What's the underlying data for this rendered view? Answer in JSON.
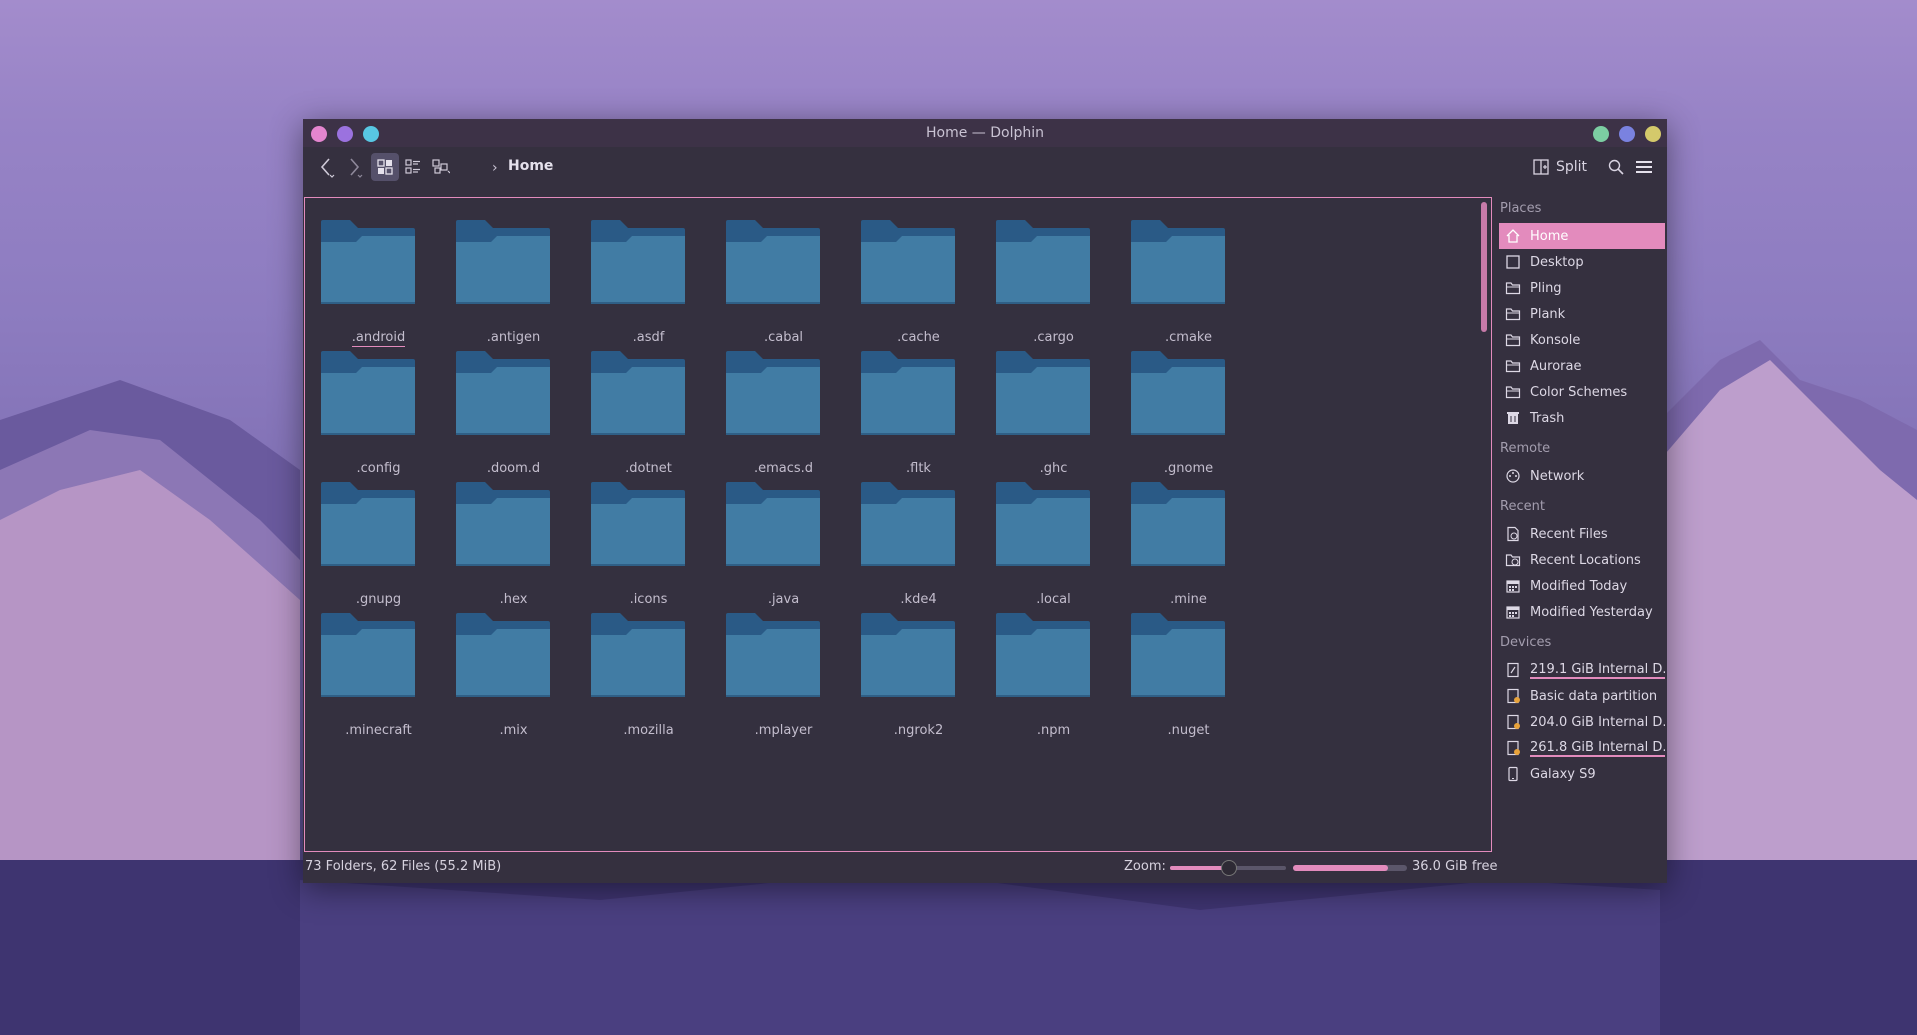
{
  "window": {
    "title": "Home — Dolphin",
    "left_buttons": [
      "#e485cf",
      "#9b72df",
      "#58c7e3"
    ],
    "right_buttons": [
      "#7ccea2",
      "#7a82e0",
      "#d4c96b"
    ]
  },
  "toolbar": {
    "back_icon": "back-icon",
    "forward_icon": "forward-icon",
    "view_modes": [
      "icons-view-icon",
      "details-view-icon",
      "compact-view-icon"
    ],
    "breadcrumb": [
      "Home"
    ],
    "split_label": "Split",
    "search_icon": "search-icon",
    "menu_icon": "hamburger-menu-icon"
  },
  "files": [
    {
      "name": ".android",
      "focused": true
    },
    {
      "name": ".antigen"
    },
    {
      "name": ".asdf"
    },
    {
      "name": ".cabal"
    },
    {
      "name": ".cache"
    },
    {
      "name": ".cargo"
    },
    {
      "name": ".cmake"
    },
    {
      "name": ".config"
    },
    {
      "name": ".doom.d"
    },
    {
      "name": ".dotnet"
    },
    {
      "name": ".emacs.d"
    },
    {
      "name": ".fltk"
    },
    {
      "name": ".ghc"
    },
    {
      "name": ".gnome"
    },
    {
      "name": ".gnupg"
    },
    {
      "name": ".hex"
    },
    {
      "name": ".icons"
    },
    {
      "name": ".java"
    },
    {
      "name": ".kde4"
    },
    {
      "name": ".local"
    },
    {
      "name": ".mine"
    },
    {
      "name": ".minecraft"
    },
    {
      "name": ".mix"
    },
    {
      "name": ".mozilla"
    },
    {
      "name": ".mplayer"
    },
    {
      "name": ".ngrok2"
    },
    {
      "name": ".npm"
    },
    {
      "name": ".nuget"
    }
  ],
  "places": {
    "sections": [
      {
        "title": "Places",
        "items": [
          {
            "label": "Home",
            "icon": "home-icon",
            "active": true
          },
          {
            "label": "Desktop",
            "icon": "desktop-icon"
          },
          {
            "label": "Pling",
            "icon": "folder-icon"
          },
          {
            "label": "Plank",
            "icon": "folder-icon"
          },
          {
            "label": "Konsole",
            "icon": "folder-icon"
          },
          {
            "label": "Aurorae",
            "icon": "folder-icon"
          },
          {
            "label": "Color Schemes",
            "icon": "folder-icon"
          },
          {
            "label": "Trash",
            "icon": "trash-icon"
          }
        ]
      },
      {
        "title": "Remote",
        "items": [
          {
            "label": "Network",
            "icon": "network-icon"
          }
        ]
      },
      {
        "title": "Recent",
        "items": [
          {
            "label": "Recent Files",
            "icon": "recent-files-icon"
          },
          {
            "label": "Recent Locations",
            "icon": "recent-locations-icon"
          },
          {
            "label": "Modified Today",
            "icon": "calendar-icon"
          },
          {
            "label": "Modified Yesterday",
            "icon": "calendar-icon"
          }
        ]
      },
      {
        "title": "Devices",
        "items": [
          {
            "label": "219.1 GiB Internal D...",
            "icon": "drive-icon",
            "underline": true
          },
          {
            "label": "Basic data partition",
            "icon": "drive-warning-icon"
          },
          {
            "label": "204.0 GiB Internal D...",
            "icon": "drive-warning-icon"
          },
          {
            "label": "261.8 GiB Internal D...",
            "icon": "drive-warning-icon",
            "underline": true
          },
          {
            "label": "Galaxy S9",
            "icon": "phone-icon"
          }
        ]
      }
    ]
  },
  "status": {
    "summary": "73 Folders, 62 Files (55.2 MiB)",
    "zoom_label": "Zoom:",
    "zoom_level": 0.5,
    "disk_used_fraction": 0.83,
    "free_space": "36.0 GiB free"
  },
  "colors": {
    "accent": "#e38bbd",
    "folder_body": "#417ca4",
    "folder_tab": "#2a5a86"
  }
}
